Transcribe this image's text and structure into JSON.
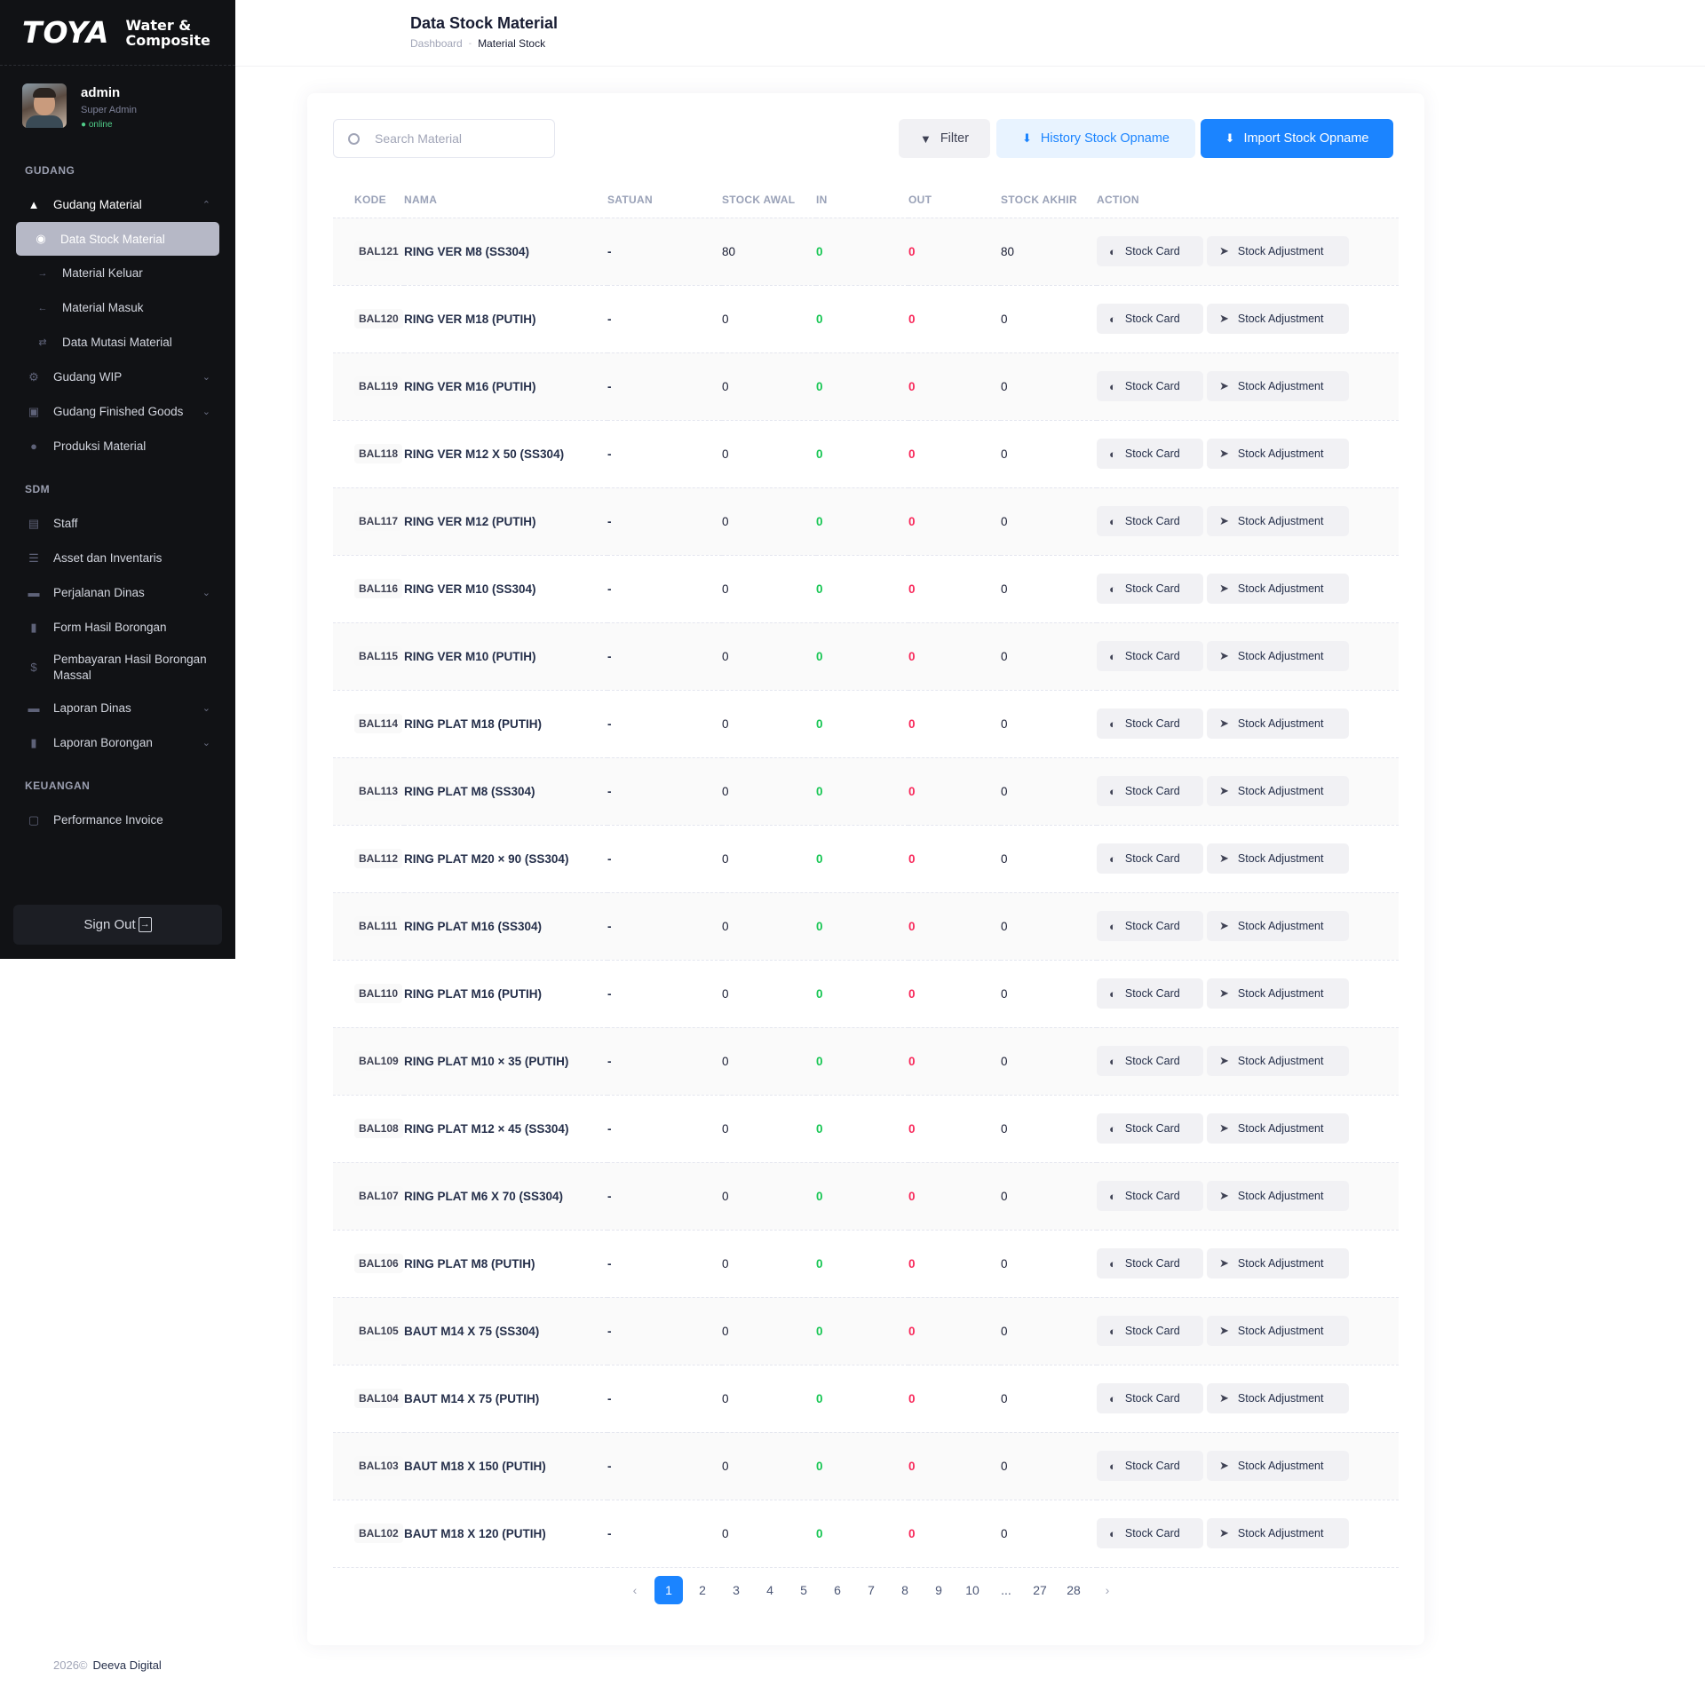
{
  "brand": {
    "logo": "TOYA",
    "subtitle_line1": "Water &",
    "subtitle_line2": "Composite"
  },
  "user": {
    "name": "admin",
    "role": "Super Admin",
    "status": "● online"
  },
  "sidebar": {
    "sections": [
      {
        "title": "GUDANG"
      },
      {
        "title": "SDM"
      },
      {
        "title": "KEUANGAN"
      }
    ],
    "gudang_items": [
      {
        "label": "Gudang Material",
        "icon": "layers-icon"
      },
      {
        "label": "Data Stock Material",
        "icon": "circle-icon"
      },
      {
        "label": "Material Keluar",
        "icon": "arrow-right-icon"
      },
      {
        "label": "Material Masuk",
        "icon": "arrow-left-icon"
      },
      {
        "label": "Data Mutasi Material",
        "icon": "swap-icon"
      },
      {
        "label": "Gudang WIP",
        "icon": "wrench-icon"
      },
      {
        "label": "Gudang Finished Goods",
        "icon": "cube-icon"
      },
      {
        "label": "Produksi Material",
        "icon": "disc-icon"
      }
    ],
    "sdm_items": [
      {
        "label": "Staff",
        "icon": "id-card-icon"
      },
      {
        "label": "Asset dan Inventaris",
        "icon": "stack-icon"
      },
      {
        "label": "Perjalanan Dinas",
        "icon": "car-icon"
      },
      {
        "label": "Form Hasil Borongan",
        "icon": "bar-chart-icon"
      },
      {
        "label": "Pembayaran Hasil Borongan Massal",
        "icon": "dollar-icon"
      },
      {
        "label": "Laporan Dinas",
        "icon": "car-icon"
      },
      {
        "label": "Laporan Borongan",
        "icon": "bar-chart-icon"
      }
    ],
    "keuangan_items": [
      {
        "label": "Performance Invoice",
        "icon": "document-icon"
      }
    ],
    "signout_label": "Sign Out"
  },
  "header": {
    "title": "Data Stock Material",
    "breadcrumb": [
      "Dashboard",
      "Material Stock"
    ]
  },
  "toolbar": {
    "search_placeholder": "Search Material",
    "filter_label": "Filter",
    "history_label": "History Stock Opname",
    "import_label": "Import Stock Opname"
  },
  "table": {
    "columns": [
      "KODE",
      "NAMA",
      "SATUAN",
      "STOCK AWAL",
      "IN",
      "OUT",
      "STOCK AKHIR",
      "ACTION"
    ],
    "action_labels": {
      "stock_card": "Stock Card",
      "stock_adjustment": "Stock Adjustment"
    },
    "rows": [
      {
        "kode": "BAL121",
        "nama": "RING VER M8 (SS304)",
        "satuan": "-",
        "awal": "80",
        "in": "0",
        "out": "0",
        "akhir": "80"
      },
      {
        "kode": "BAL120",
        "nama": "RING VER M18 (PUTIH)",
        "satuan": "-",
        "awal": "0",
        "in": "0",
        "out": "0",
        "akhir": "0"
      },
      {
        "kode": "BAL119",
        "nama": "RING VER M16 (PUTIH)",
        "satuan": "-",
        "awal": "0",
        "in": "0",
        "out": "0",
        "akhir": "0"
      },
      {
        "kode": "BAL118",
        "nama": "RING VER M12 X 50 (SS304)",
        "satuan": "-",
        "awal": "0",
        "in": "0",
        "out": "0",
        "akhir": "0"
      },
      {
        "kode": "BAL117",
        "nama": "RING VER M12 (PUTIH)",
        "satuan": "-",
        "awal": "0",
        "in": "0",
        "out": "0",
        "akhir": "0"
      },
      {
        "kode": "BAL116",
        "nama": "RING VER M10 (SS304)",
        "satuan": "-",
        "awal": "0",
        "in": "0",
        "out": "0",
        "akhir": "0"
      },
      {
        "kode": "BAL115",
        "nama": "RING VER M10 (PUTIH)",
        "satuan": "-",
        "awal": "0",
        "in": "0",
        "out": "0",
        "akhir": "0"
      },
      {
        "kode": "BAL114",
        "nama": "RING PLAT M18 (PUTIH)",
        "satuan": "-",
        "awal": "0",
        "in": "0",
        "out": "0",
        "akhir": "0"
      },
      {
        "kode": "BAL113",
        "nama": "RING PLAT M8 (SS304)",
        "satuan": "-",
        "awal": "0",
        "in": "0",
        "out": "0",
        "akhir": "0"
      },
      {
        "kode": "BAL112",
        "nama": "RING PLAT M20 × 90 (SS304)",
        "satuan": "-",
        "awal": "0",
        "in": "0",
        "out": "0",
        "akhir": "0"
      },
      {
        "kode": "BAL111",
        "nama": "RING PLAT M16 (SS304)",
        "satuan": "-",
        "awal": "0",
        "in": "0",
        "out": "0",
        "akhir": "0"
      },
      {
        "kode": "BAL110",
        "nama": "RING PLAT M16 (PUTIH)",
        "satuan": "-",
        "awal": "0",
        "in": "0",
        "out": "0",
        "akhir": "0"
      },
      {
        "kode": "BAL109",
        "nama": "RING PLAT M10 × 35 (PUTIH)",
        "satuan": "-",
        "awal": "0",
        "in": "0",
        "out": "0",
        "akhir": "0"
      },
      {
        "kode": "BAL108",
        "nama": "RING PLAT M12 × 45 (SS304)",
        "satuan": "-",
        "awal": "0",
        "in": "0",
        "out": "0",
        "akhir": "0"
      },
      {
        "kode": "BAL107",
        "nama": "RING PLAT M6 X 70 (SS304)",
        "satuan": "-",
        "awal": "0",
        "in": "0",
        "out": "0",
        "akhir": "0"
      },
      {
        "kode": "BAL106",
        "nama": "RING PLAT M8 (PUTIH)",
        "satuan": "-",
        "awal": "0",
        "in": "0",
        "out": "0",
        "akhir": "0"
      },
      {
        "kode": "BAL105",
        "nama": "BAUT M14 X 75 (SS304)",
        "satuan": "-",
        "awal": "0",
        "in": "0",
        "out": "0",
        "akhir": "0"
      },
      {
        "kode": "BAL104",
        "nama": "BAUT M14 X 75 (PUTIH)",
        "satuan": "-",
        "awal": "0",
        "in": "0",
        "out": "0",
        "akhir": "0"
      },
      {
        "kode": "BAL103",
        "nama": "BAUT M18 X 150 (PUTIH)",
        "satuan": "-",
        "awal": "0",
        "in": "0",
        "out": "0",
        "akhir": "0"
      },
      {
        "kode": "BAL102",
        "nama": "BAUT M18 X 120 (PUTIH)",
        "satuan": "-",
        "awal": "0",
        "in": "0",
        "out": "0",
        "akhir": "0"
      }
    ]
  },
  "pagination": {
    "prev": "‹",
    "next": "›",
    "pages": [
      "1",
      "2",
      "3",
      "4",
      "5",
      "6",
      "7",
      "8",
      "9",
      "10",
      "...",
      "27",
      "28"
    ],
    "current": "1"
  },
  "footer": {
    "year": "2026©",
    "company": "Deeva Digital"
  },
  "colors": {
    "primary": "#1b84ff",
    "success": "#17c653",
    "danger": "#f8285a",
    "sidebar_bg": "#111215"
  }
}
